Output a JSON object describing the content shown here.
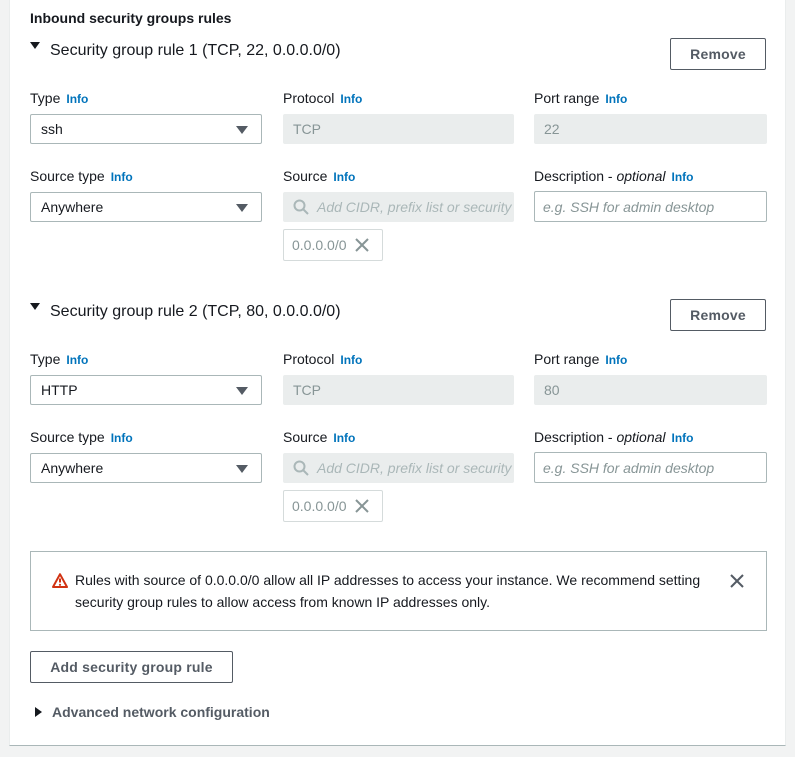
{
  "section_title": "Inbound security groups rules",
  "rules": [
    {
      "title": "Security group rule 1 (TCP, 22, 0.0.0.0/0)",
      "remove_label": "Remove",
      "type_label": "Type",
      "type_value": "ssh",
      "protocol_label": "Protocol",
      "protocol_value": "TCP",
      "port_label": "Port range",
      "port_value": "22",
      "source_type_label": "Source type",
      "source_type_value": "Anywhere",
      "source_label": "Source",
      "source_placeholder": "Add CIDR, prefix list or security",
      "source_token": "0.0.0.0/0",
      "description_label": "Description - ",
      "description_optional": "optional",
      "description_placeholder": "e.g. SSH for admin desktop"
    },
    {
      "title": "Security group rule 2 (TCP, 80, 0.0.0.0/0)",
      "remove_label": "Remove",
      "type_label": "Type",
      "type_value": "HTTP",
      "protocol_label": "Protocol",
      "protocol_value": "TCP",
      "port_label": "Port range",
      "port_value": "80",
      "source_type_label": "Source type",
      "source_type_value": "Anywhere",
      "source_label": "Source",
      "source_placeholder": "Add CIDR, prefix list or security",
      "source_token": "0.0.0.0/0",
      "description_label": "Description - ",
      "description_optional": "optional",
      "description_placeholder": "e.g. SSH for admin desktop"
    }
  ],
  "info_link": "Info",
  "alert": {
    "text": "Rules with source of 0.0.0.0/0 allow all IP addresses to access your instance. We recommend setting security group rules to allow access from known IP addresses only.",
    "icon": "warning-icon",
    "color": "#d13212"
  },
  "add_rule_label": "Add security group rule",
  "advanced_label": "Advanced network configuration",
  "colors": {
    "link": "#0073bb",
    "border": "#aab7b8",
    "disabled_bg": "#eaeded"
  }
}
